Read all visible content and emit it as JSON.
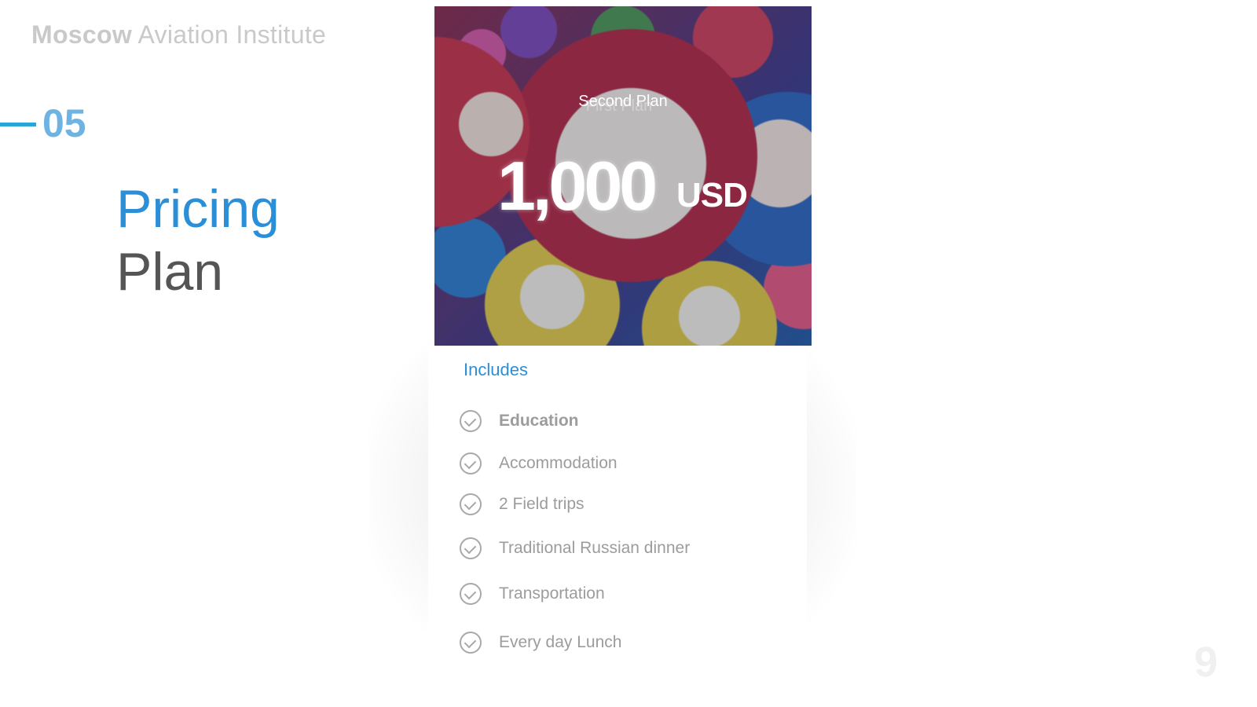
{
  "brand": {
    "bold": "Moscow",
    "rest": "Aviation Institute"
  },
  "section": {
    "number": "05"
  },
  "title": {
    "line1": "Pricing",
    "line2": "Plan"
  },
  "card": {
    "plan_name": "Second Plan",
    "plan_name_ghost": "First Plan",
    "price": "1,000",
    "currency": "USD",
    "includes_label": "Includes",
    "features": [
      {
        "label": "Education",
        "icon": "check-circle-icon"
      },
      {
        "label": "Accommodation",
        "icon": "check-circle-icon"
      },
      {
        "label": "2 Field trips",
        "icon": "check-circle-icon"
      },
      {
        "label": "Traditional Russian dinner",
        "icon": "check-circle-icon"
      },
      {
        "label": "Transportation",
        "icon": "check-circle-icon"
      },
      {
        "label": "Every day Lunch",
        "icon": "check-circle-icon"
      }
    ]
  },
  "page": {
    "number": "9"
  },
  "colors": {
    "accent": "#2a8fd6",
    "section_number": "#6fb3e3",
    "muted_text": "#9c9c9c"
  }
}
